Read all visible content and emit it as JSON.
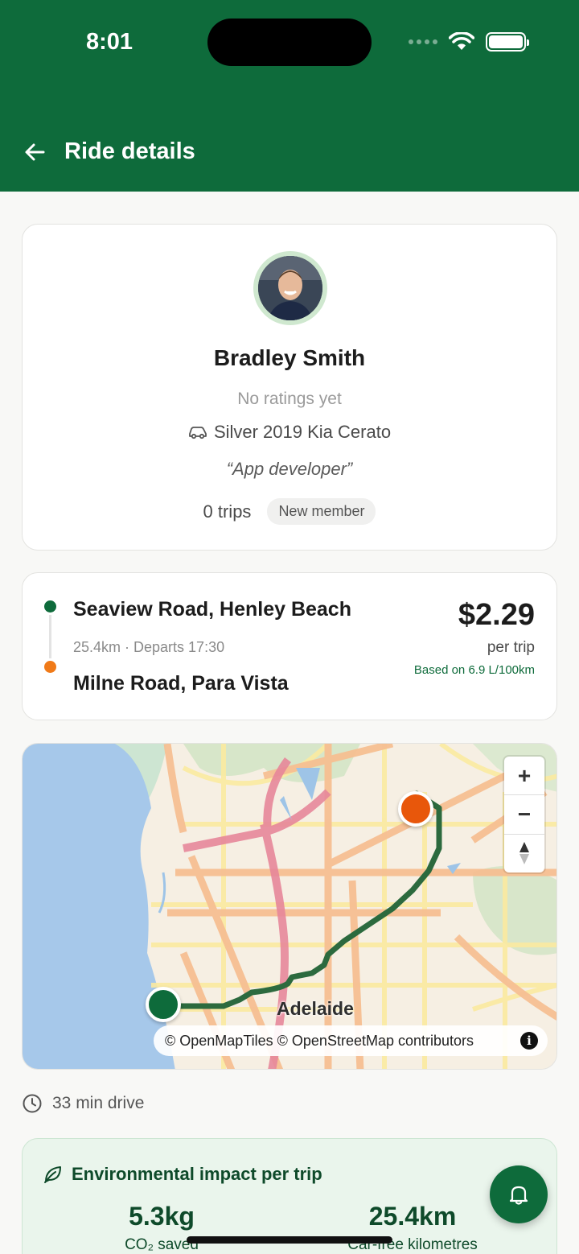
{
  "status_bar": {
    "time": "8:01"
  },
  "header": {
    "title": "Ride details"
  },
  "driver": {
    "name": "Bradley Smith",
    "rating": "No ratings yet",
    "car": "Silver 2019 Kia Cerato",
    "bio": "“App developer”",
    "trips": "0 trips",
    "badge": "New member"
  },
  "route": {
    "origin": "Seaview Road, Henley Beach",
    "meta": "25.4km · Departs 17:30",
    "destination": "Milne Road, Para Vista",
    "price": "$2.29",
    "price_unit": "per trip",
    "fuel_basis": "Based on 6.9 L/100km"
  },
  "map": {
    "city_label": "Adelaide",
    "attribution": "© OpenMapTiles © OpenStreetMap contributors",
    "zoom_in": "+",
    "zoom_out": "−"
  },
  "trip": {
    "duration": "33 min drive"
  },
  "environment": {
    "title": "Environmental impact per trip",
    "co2_value": "5.3kg",
    "co2_label": "CO₂ saved",
    "km_value": "25.4km",
    "km_label": "Car-free kilometres"
  },
  "colors": {
    "brand": "#0e6b3b",
    "origin_marker": "#0e6b3b",
    "destination_marker": "#e8570b"
  },
  "icons": [
    "back-arrow-icon",
    "wifi-icon",
    "battery-icon",
    "car-icon",
    "clock-icon",
    "leaf-icon",
    "bell-icon",
    "info-icon",
    "compass-icon"
  ]
}
